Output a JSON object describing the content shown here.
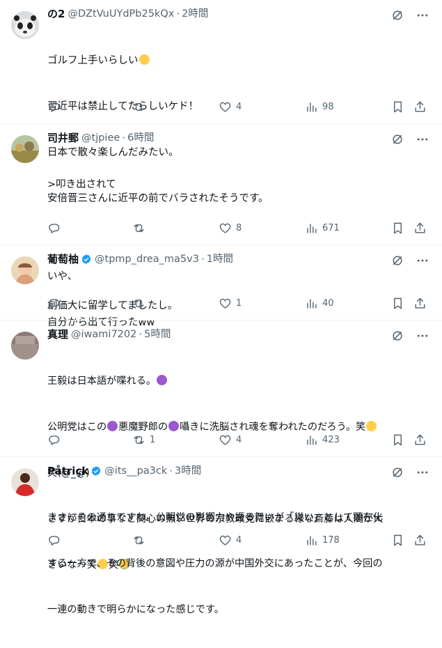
{
  "tweets": [
    {
      "name": "の2",
      "handle": "@DZtVuUYdPb25kQx",
      "time": "2時間",
      "lines": [
        "ゴルフ上手いらしい",
        "習近平は禁止してたらしいケド！",
        "日本で散々楽しんだみたい。",
        "安倍晋三さんに近平の前でバラされたそうです。"
      ],
      "replies": "",
      "retweets": "",
      "likes": "4",
      "views": "98"
    },
    {
      "name": "司井郵",
      "handle": "@tjpiee",
      "time": "6時間",
      "lines": [
        ">叩き出されて",
        "",
        "いや、",
        "自分から出て行ったww"
      ],
      "replies": "",
      "retweets": "",
      "likes": "8",
      "views": "671"
    },
    {
      "name": "葡萄柚",
      "handle": "@tpmp_drea_ma5v3",
      "time": "1時間",
      "lines": [
        "創価大に留学してましたし。"
      ],
      "replies": "",
      "retweets": "",
      "likes": "1",
      "views": "40"
    },
    {
      "name": "真理",
      "handle": "@iwami7202",
      "time": "5時間",
      "lines": [
        "王毅は日本語が喋れる。",
        "公明党はこの",
        "悪魔野郎の",
        "囁きに洗脳され魂を奪われたのだろう。笑",
        "笑(@_@)",
        "さすが日本の事など関心の無い世界の宗教政党に嵌まる様な斎藤は人間が大",
        "きいな〜笑",
        "笑"
      ],
      "replies": "",
      "retweets": "1",
      "likes": "4",
      "views": "423"
    },
    {
      "name": "Påtriçk",
      "handle": "@its__pa3ck",
      "time": "3時間",
      "lines": [
        "まさにその通りですね。公明党の影響力や振る舞いが「災い」として顕在化",
        "する一方で、その背後の意図や圧力の源が中国外交にあったことが、今回の",
        "一連の動きで明らかになった感じです。"
      ],
      "replies": "",
      "retweets": "",
      "likes": "4",
      "views": "178"
    }
  ],
  "separator": "·",
  "colors": {
    "text": "#0f1419",
    "secondary": "#536471",
    "verified": "#1d9bf0",
    "border": "#eff3f4"
  }
}
